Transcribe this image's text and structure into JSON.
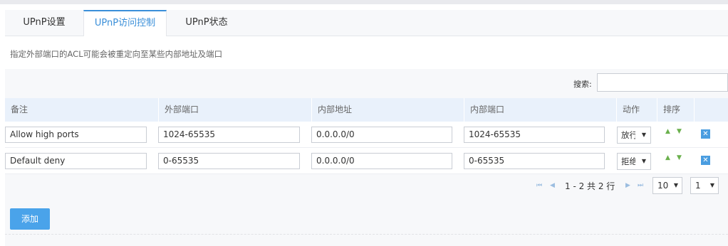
{
  "tabs": [
    {
      "label": "UPnP设置"
    },
    {
      "label": "UPnP访问控制"
    },
    {
      "label": "UPnP状态"
    }
  ],
  "description": "指定外部端口的ACL可能会被重定向至某些内部地址及端口",
  "search": {
    "label": "搜索:",
    "value": ""
  },
  "table": {
    "headers": [
      "备注",
      "外部端口",
      "内部地址",
      "内部端口",
      "动作",
      "排序"
    ],
    "rows": [
      {
        "note": "Allow high ports",
        "ext_port": "1024-65535",
        "int_addr": "0.0.0.0/0",
        "int_port": "1024-65535",
        "action": "放行"
      },
      {
        "note": "Default deny",
        "ext_port": "0-65535",
        "int_addr": "0.0.0.0/0",
        "int_port": "0-65535",
        "action": "拒绝"
      }
    ]
  },
  "pagination": {
    "summary": "1 - 2 共 2 行",
    "page_size": "10",
    "page": "1"
  },
  "add_button": "添加",
  "colors": {
    "accent": "#3a8fd9",
    "button": "#4aa3ea",
    "header_bg": "#e9f1fb",
    "sort_arrow": "#6ab04c"
  }
}
